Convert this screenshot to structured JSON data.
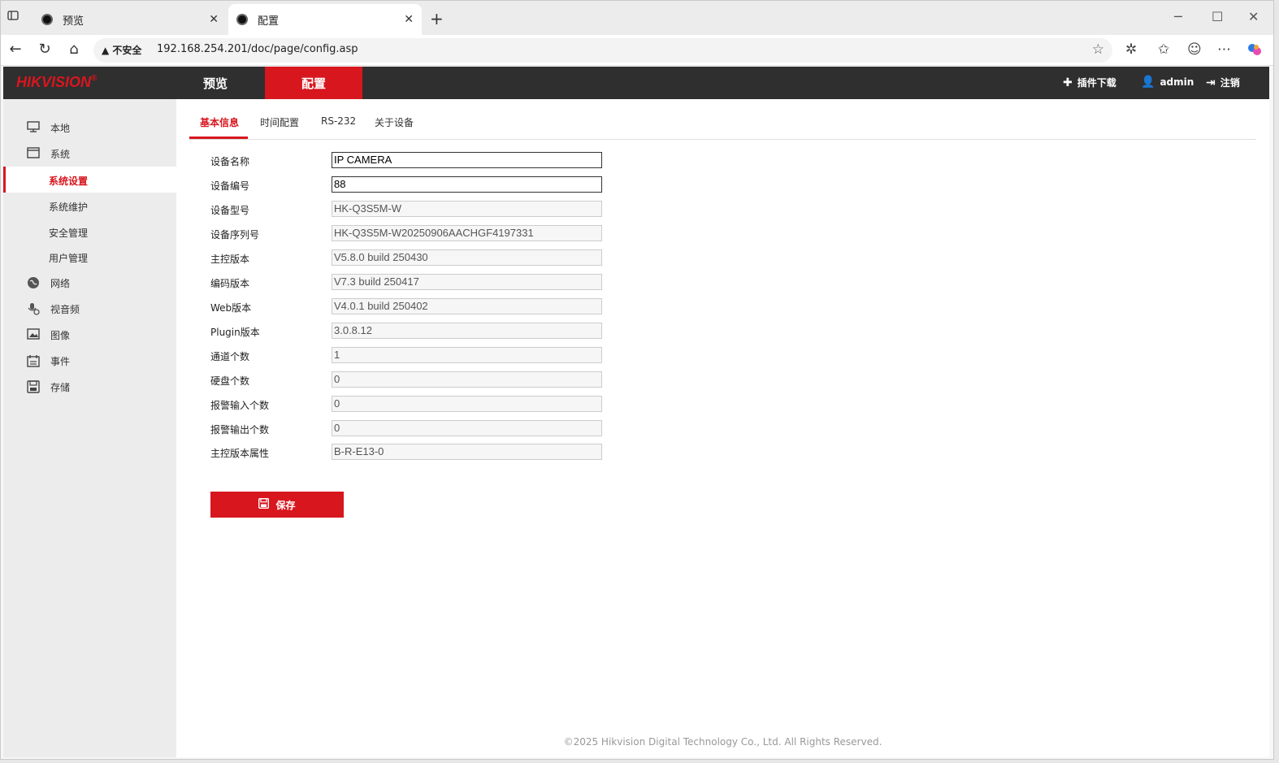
{
  "browser": {
    "tabs": [
      {
        "label": "预览"
      },
      {
        "label": "配置"
      }
    ],
    "new_tab": "+",
    "security_label": "不安全",
    "url": "192.168.254.201/doc/page/config.asp"
  },
  "header": {
    "logo": "HIKVISION",
    "logo_mark": "®",
    "nav": [
      {
        "label": "预览"
      },
      {
        "label": "配置"
      }
    ],
    "plugin_download": "插件下载",
    "user": "admin",
    "logout": "注销"
  },
  "sidebar": {
    "items": [
      {
        "label": "本地",
        "icon": "monitor-icon"
      },
      {
        "label": "系统",
        "icon": "window-icon"
      },
      {
        "label": "网络",
        "icon": "globe-icon"
      },
      {
        "label": "视音频",
        "icon": "microphone-icon"
      },
      {
        "label": "图像",
        "icon": "image-icon"
      },
      {
        "label": "事件",
        "icon": "calendar-icon"
      },
      {
        "label": "存储",
        "icon": "disk-icon"
      }
    ],
    "sub_items": [
      {
        "label": "系统设置"
      },
      {
        "label": "系统维护"
      },
      {
        "label": "安全管理"
      },
      {
        "label": "用户管理"
      }
    ]
  },
  "subtabs": [
    {
      "label": "基本信息"
    },
    {
      "label": "时间配置"
    },
    {
      "label": "RS-232"
    },
    {
      "label": "关于设备"
    }
  ],
  "form": {
    "fields": [
      {
        "label": "设备名称",
        "value": "IP CAMERA"
      },
      {
        "label": "设备编号",
        "value": "88"
      },
      {
        "label": "设备型号",
        "value": "HK-Q3S5M-W"
      },
      {
        "label": "设备序列号",
        "value": "HK-Q3S5M-W20250906AACHGF4197331"
      },
      {
        "label": "主控版本",
        "value": "V5.8.0 build 250430"
      },
      {
        "label": "编码版本",
        "value": "V7.3 build 250417"
      },
      {
        "label": "Web版本",
        "value": "V4.0.1 build 250402"
      },
      {
        "label": "Plugin版本",
        "value": "3.0.8.12"
      },
      {
        "label": "通道个数",
        "value": "1"
      },
      {
        "label": "硬盘个数",
        "value": "0"
      },
      {
        "label": "报警输入个数",
        "value": "0"
      },
      {
        "label": "报警输出个数",
        "value": "0"
      },
      {
        "label": "主控版本属性",
        "value": "B-R-E13-0"
      }
    ],
    "save_label": "保存"
  },
  "footer": "©2025 Hikvision Digital Technology Co., Ltd. All Rights Reserved.",
  "colors": {
    "brand": "#d7161e",
    "header_bg": "#2f2f2f"
  }
}
